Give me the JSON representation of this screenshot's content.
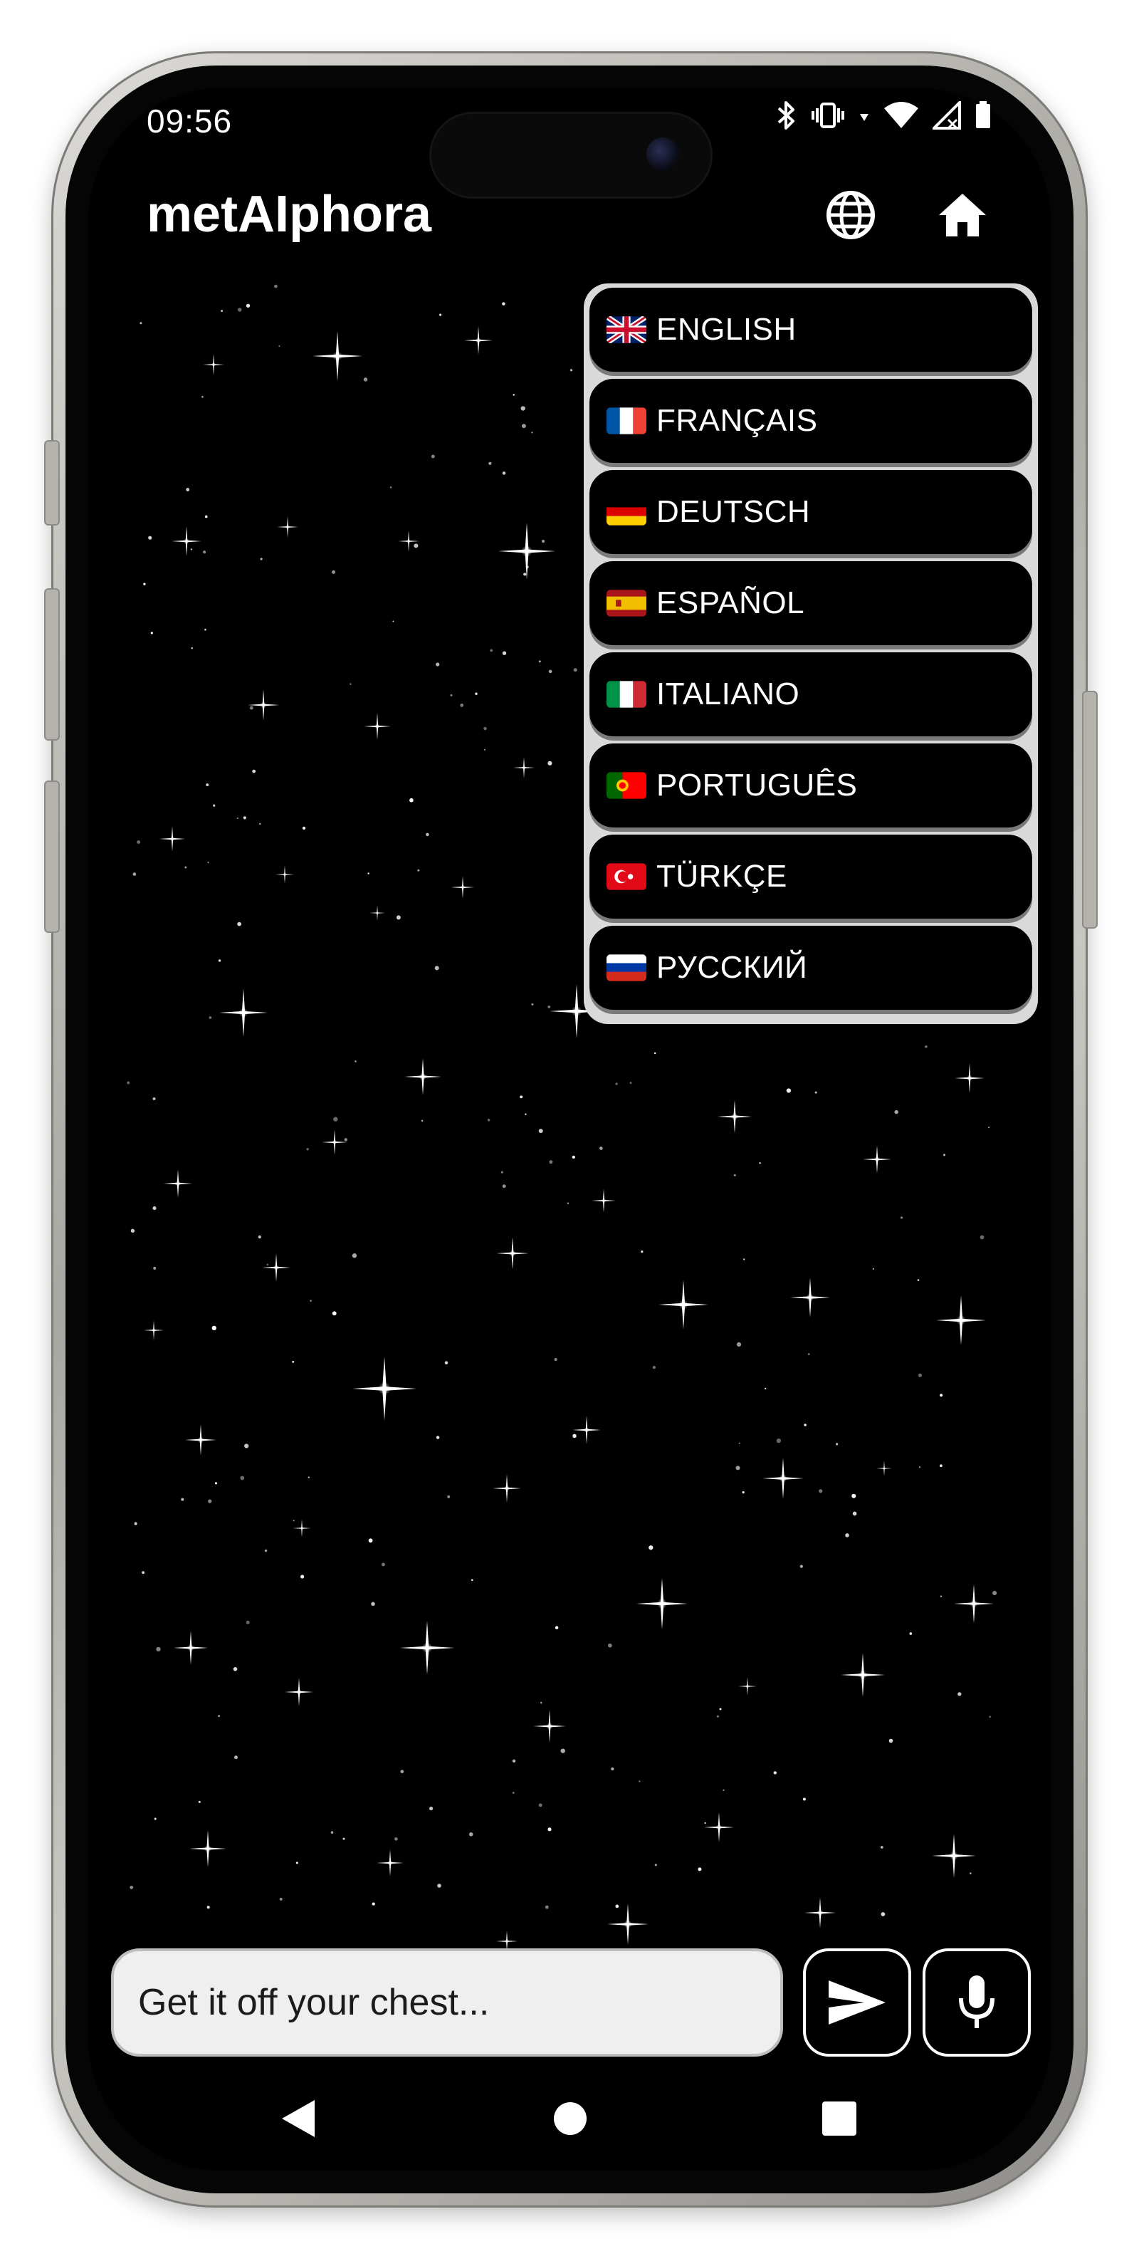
{
  "status_bar": {
    "time": "09:56",
    "icons": [
      "bluetooth-icon",
      "vibrate-icon",
      "wifi-icon",
      "signal-icon",
      "battery-icon"
    ]
  },
  "app": {
    "title": "metAIphora"
  },
  "top_bar": {
    "icons": [
      "globe-icon",
      "home-icon"
    ]
  },
  "language_menu": {
    "items": [
      {
        "label": "ENGLISH",
        "flag": "uk-flag"
      },
      {
        "label": "FRANÇAIS",
        "flag": "france-flag"
      },
      {
        "label": "DEUTSCH",
        "flag": "germany-flag"
      },
      {
        "label": "ESPAÑOL",
        "flag": "spain-flag"
      },
      {
        "label": "ITALIANO",
        "flag": "italy-flag"
      },
      {
        "label": "PORTUGUÊS",
        "flag": "portugal-flag"
      },
      {
        "label": "TÜRKÇE",
        "flag": "turkey-flag"
      },
      {
        "label": "РУССКИЙ",
        "flag": "russia-flag"
      }
    ]
  },
  "composer": {
    "placeholder": "Get it off your chest...",
    "send_icon": "send-icon",
    "mic_icon": "microphone-icon"
  },
  "nav_bar": {
    "icons": [
      "back-icon",
      "home-circle-icon",
      "recents-icon"
    ]
  },
  "colors": {
    "background": "#000000",
    "frame": "#b5b3ae",
    "menu_border": "#d9d9d9",
    "input_background": "#efefef"
  }
}
